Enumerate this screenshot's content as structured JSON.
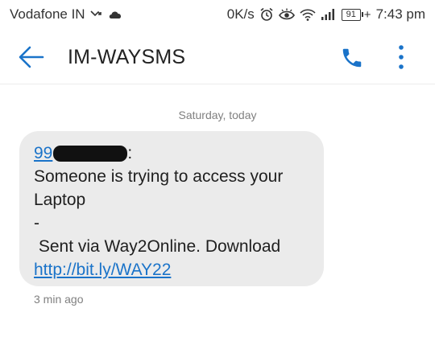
{
  "status_bar": {
    "carrier": "Vodafone IN",
    "data_speed": "0K/s",
    "battery_level": "91",
    "charging_indicator": "+",
    "time": "7:43 pm"
  },
  "app_bar": {
    "title": "IM-WAYSMS",
    "back_icon": "arrow-back-icon",
    "call_icon": "phone-icon",
    "more_icon": "more-vertical-icon"
  },
  "conversation": {
    "date_header": "Saturday, today",
    "message": {
      "sender_prefix": "99",
      "sender_suffix": ":",
      "line1": "Someone is trying to access your",
      "line2": "Laptop",
      "line3": "-",
      "line4": " Sent via Way2Online. Download",
      "link": "http://bit.ly/WAY22",
      "timestamp": "3 min ago"
    }
  },
  "colors": {
    "accent": "#1a73c9",
    "bubble": "#ebebeb",
    "muted_text": "#808080"
  }
}
